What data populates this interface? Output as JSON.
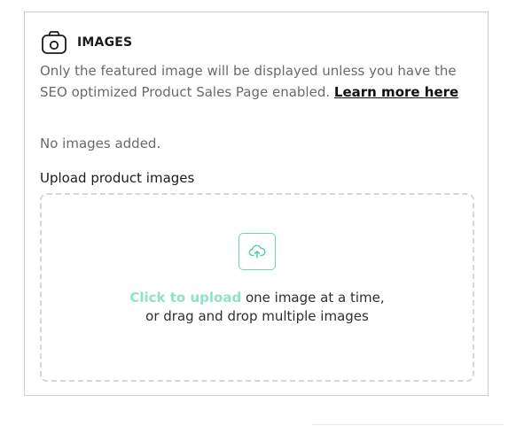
{
  "images_section": {
    "title": "IMAGES",
    "icon": "camera-icon",
    "description": "Only the featured image will be displayed unless you have the SEO optimized Product Sales Page enabled.",
    "learn_more_link": "Learn more here",
    "empty_state": "No images added.",
    "upload_label": "Upload product images",
    "dropzone": {
      "icon": "cloud-upload-icon",
      "click_text": "Click to upload",
      "line1_rest": "one image at a time,",
      "line2": "or drag and drop multiple images"
    }
  },
  "colors": {
    "accent": "#6fd6b0",
    "accent_text": "#8fe3c1",
    "border": "#cfcfcf",
    "muted_text": "#6a6a6a"
  }
}
